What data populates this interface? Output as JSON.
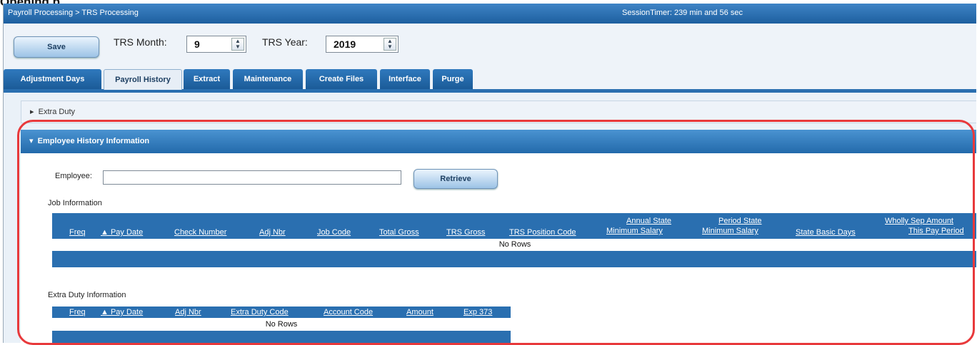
{
  "page_heading": "Opening p...",
  "topbar": {
    "breadcrumb": "Payroll Processing > TRS Processing",
    "session_timer": "SessionTimer: 239 min and 56 sec"
  },
  "toolbar": {
    "save_label": "Save",
    "trs_month_label": "TRS Month:",
    "trs_month_value": "9",
    "trs_year_label": "TRS Year:",
    "trs_year_value": "2019"
  },
  "tabs": [
    {
      "label": "Adjustment Days"
    },
    {
      "label": "Payroll History"
    },
    {
      "label": "Extract"
    },
    {
      "label": "Maintenance"
    },
    {
      "label": "Create Files"
    },
    {
      "label": "Interface"
    },
    {
      "label": "Purge"
    }
  ],
  "active_tab": "Payroll History",
  "sections": {
    "extra_duty": "Extra Duty",
    "employee_history": "Employee History Information"
  },
  "employee": {
    "label": "Employee:",
    "value": "",
    "retrieve_label": "Retrieve"
  },
  "job_information": {
    "label": "Job Information",
    "columns": [
      {
        "line1": "",
        "line2": "Freq"
      },
      {
        "line1": "",
        "line2": "▲ Pay Date"
      },
      {
        "line1": "",
        "line2": "Check Number"
      },
      {
        "line1": "",
        "line2": "Adj Nbr"
      },
      {
        "line1": "",
        "line2": "Job Code"
      },
      {
        "line1": "",
        "line2": "Total Gross"
      },
      {
        "line1": "",
        "line2": "TRS Gross"
      },
      {
        "line1": "",
        "line2": "TRS Position Code"
      },
      {
        "line1": "Annual State",
        "line2": "Minimum Salary"
      },
      {
        "line1": "Period State",
        "line2": "Minimum Salary"
      },
      {
        "line1": "",
        "line2": "State Basic Days"
      },
      {
        "line1": "Wholly Sep Amount",
        "line2": "This Pay Period"
      }
    ],
    "empty_text": "No Rows"
  },
  "extra_duty_information": {
    "label": "Extra Duty Information",
    "columns": [
      {
        "line2": "Freq"
      },
      {
        "line2": "▲ Pay Date"
      },
      {
        "line2": "Adj Nbr"
      },
      {
        "line2": "Extra Duty Code"
      },
      {
        "line2": "Account Code"
      },
      {
        "line2": "Amount"
      },
      {
        "line2": "Exp 373"
      }
    ],
    "empty_text": "No Rows"
  },
  "highlight_color": "#e8393b",
  "accent_color": "#2a6fb0"
}
